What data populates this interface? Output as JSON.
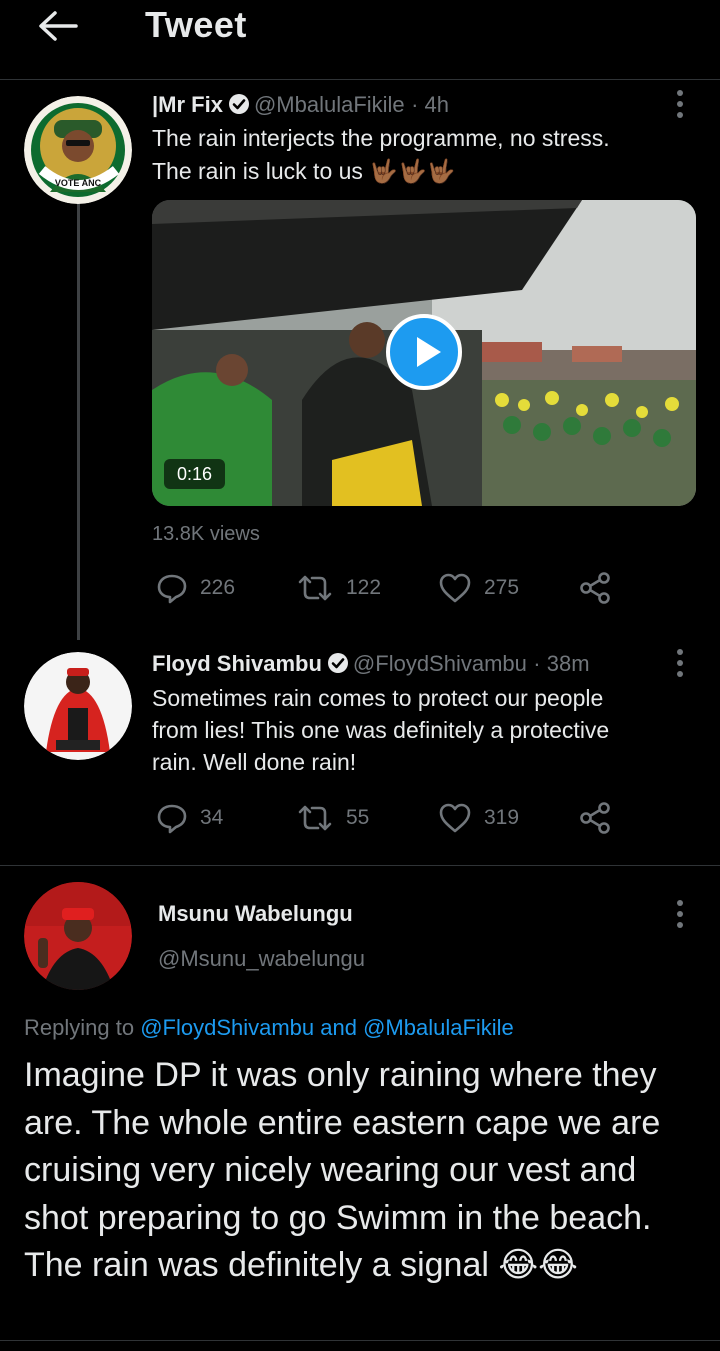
{
  "header": {
    "title": "Tweet"
  },
  "tweets": [
    {
      "name": "|Mr Fix",
      "handle": "@MbalulaFikile",
      "time": "· 4h",
      "text_lines": [
        "The rain interjects the programme, no stress.",
        "The rain is luck to us 🤟🏾🤟🏾🤟🏾"
      ],
      "video": {
        "duration": "0:16"
      },
      "views": "13.8K views",
      "stats": {
        "replies": "226",
        "retweets": "122",
        "likes": "275"
      },
      "avatar_badge": "REGISTERED TO VOTE ANC"
    },
    {
      "name": "Floyd Shivambu",
      "handle": "@FloydShivambu",
      "time": "· 38m",
      "text_lines": [
        "Sometimes rain comes to protect our people",
        "from lies! This one was definitely a protective",
        "rain. Well done rain!"
      ],
      "stats": {
        "replies": "34",
        "retweets": "55",
        "likes": "319"
      }
    }
  ],
  "main_tweet": {
    "name": "Msunu Wabelungu",
    "handle": "@Msunu_wabelungu",
    "replying_to_label": "Replying to ",
    "replying_to_users": "@FloydShivambu and @MbalulaFikile",
    "text": "Imagine DP it was only raining where they are. The whole entire eastern cape we are cruising very nicely wearing our vest and shot preparing to go Swimm in the beach. The rain was definitely a signal 😂😂"
  },
  "colors": {
    "background": "#000000",
    "text": "#e7e9ea",
    "muted": "#71767b",
    "accent": "#1d9bf0",
    "divider": "#2f3336"
  },
  "icons": [
    "back-arrow-icon",
    "verified-badge-icon",
    "more-options-icon",
    "play-icon",
    "reply-icon",
    "retweet-icon",
    "like-icon",
    "share-icon"
  ]
}
